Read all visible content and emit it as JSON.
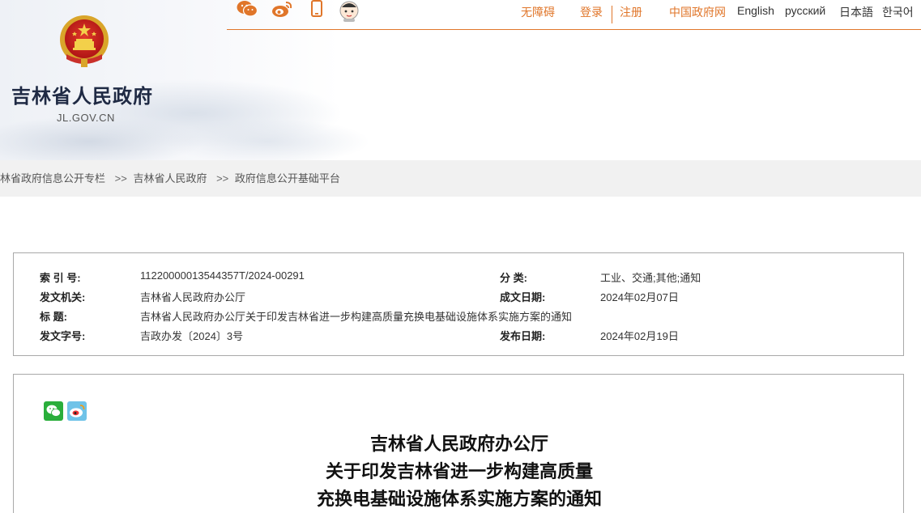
{
  "header": {
    "site_title": "吉林省人民政府",
    "site_domain": "JL.GOV.CN",
    "icons": [
      "wechat-icon",
      "weibo-icon",
      "mobile-icon",
      "robot-assistant-icon"
    ],
    "links": {
      "accessibility": "无障碍",
      "login": "登录",
      "register": "注册",
      "china_gov": "中国政府网",
      "english": "English",
      "russian": "русский",
      "japanese": "日本語",
      "korean": "한국어"
    },
    "accent_color": "#e0762a"
  },
  "breadcrumb": {
    "items": [
      "林省政府信息公开专栏",
      "吉林省人民政府",
      "政府信息公开基础平台"
    ],
    "separator": ">>"
  },
  "info": {
    "index_label": "索 引 号:",
    "index_value": "11220000013544357T/2024-00291",
    "category_label": "分 类:",
    "category_value": "工业、交通;其他;通知",
    "issuer_label": "发文机关:",
    "issuer_value": "吉林省人民政府办公厅",
    "created_label": "成文日期:",
    "created_value": "2024年02月07日",
    "title_label": "标 题:",
    "title_value": "吉林省人民政府办公厅关于印发吉林省进一步构建高质量充换电基础设施体系实施方案的通知",
    "docno_label": "发文字号:",
    "docno_value": "吉政办发〔2024〕3号",
    "published_label": "发布日期:",
    "published_value": "2024年02月19日"
  },
  "document": {
    "title_lines": [
      "吉林省人民政府办公厅",
      "关于印发吉林省进一步构建高质量",
      "充换电基础设施体系实施方案的通知"
    ]
  }
}
